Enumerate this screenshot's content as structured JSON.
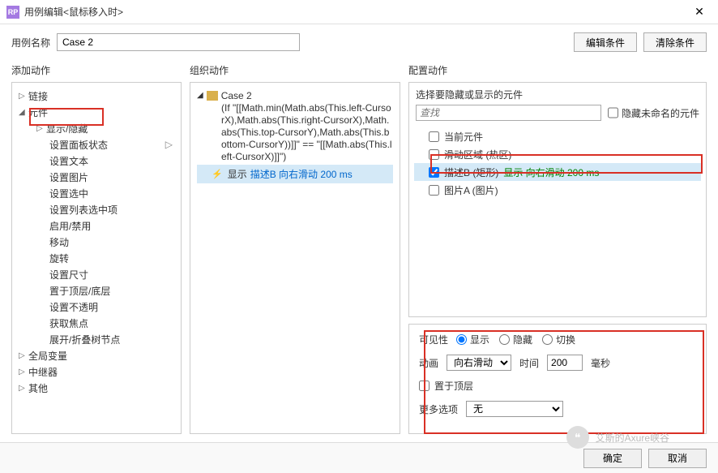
{
  "window": {
    "title": "用例编辑<鼠标移入时>",
    "close": "✕"
  },
  "nameRow": {
    "label": "用例名称",
    "value": "Case 2",
    "editCondBtn": "编辑条件",
    "clearCondBtn": "清除条件"
  },
  "columns": {
    "addAction": "添加动作",
    "orgAction": "组织动作",
    "cfgAction": "配置动作"
  },
  "actionTree": {
    "items": [
      {
        "label": "链接",
        "expand": "▷",
        "level": 0
      },
      {
        "label": "元件",
        "expand": "◢",
        "level": 0
      },
      {
        "label": "显示/隐藏",
        "expand": "▷",
        "level": 1,
        "hl": true
      },
      {
        "label": "设置面板状态",
        "expand": "",
        "level": 2,
        "more": "▷"
      },
      {
        "label": "设置文本",
        "expand": "",
        "level": 2
      },
      {
        "label": "设置图片",
        "expand": "",
        "level": 2
      },
      {
        "label": "设置选中",
        "expand": "",
        "level": 2
      },
      {
        "label": "设置列表选中项",
        "expand": "",
        "level": 2
      },
      {
        "label": "启用/禁用",
        "expand": "",
        "level": 2
      },
      {
        "label": "移动",
        "expand": "",
        "level": 2
      },
      {
        "label": "旋转",
        "expand": "",
        "level": 2
      },
      {
        "label": "设置尺寸",
        "expand": "",
        "level": 2
      },
      {
        "label": "置于顶层/底层",
        "expand": "",
        "level": 2
      },
      {
        "label": "设置不透明",
        "expand": "",
        "level": 2
      },
      {
        "label": "获取焦点",
        "expand": "",
        "level": 2
      },
      {
        "label": "展开/折叠树节点",
        "expand": "",
        "level": 2
      },
      {
        "label": "全局变量",
        "expand": "▷",
        "level": 0
      },
      {
        "label": "中继器",
        "expand": "▷",
        "level": 0
      },
      {
        "label": "其他",
        "expand": "▷",
        "level": 0
      }
    ]
  },
  "caseBlock": {
    "caseName": "Case 2",
    "condition": "(If \"[[Math.min(Math.abs(This.left-CursorX),Math.abs(This.right-CursorX),Math.abs(This.top-CursorY),Math.abs(This.bottom-CursorY))]]\" == \"[[Math.abs(This.left-CursorX)]]\")",
    "actionShow": "显示",
    "actionLink": "描述B 向右滑动 200 ms"
  },
  "config": {
    "selectTitle": "选择要隐藏或显示的元件",
    "searchPlaceholder": "查找",
    "hideUnnamed": "隐藏未命名的元件",
    "widgets": [
      {
        "name": "当前元件",
        "checked": false
      },
      {
        "name": "滑动区域 (热区)",
        "checked": false
      },
      {
        "name": "描述B (矩形)",
        "checked": true,
        "extra": "显示 向右滑动 200 ms",
        "sel": true
      },
      {
        "name": "图片A (图片)",
        "checked": false
      }
    ],
    "visibilityLabel": "可见性",
    "visOptions": {
      "show": "显示",
      "hide": "隐藏",
      "toggle": "切换"
    },
    "animLabel": "动画",
    "animValue": "向右滑动",
    "timeLabel": "时间",
    "timeValue": "200",
    "timeUnit": "毫秒",
    "bringFront": "置于顶层",
    "moreLabel": "更多选项",
    "moreValue": "无"
  },
  "footer": {
    "ok": "确定",
    "cancel": "取消"
  },
  "watermark": "艾斯的Axure峡谷"
}
